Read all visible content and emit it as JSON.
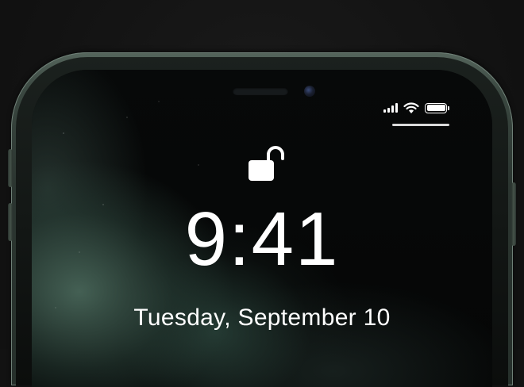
{
  "lock_screen": {
    "time": "9:41",
    "date": "Tuesday, September 10",
    "lock_state": "unlocked"
  },
  "status_bar": {
    "signal_bars": 4,
    "wifi": "wifi-icon",
    "battery_level": 1.0
  },
  "icons": {
    "lock": "unlocked-padlock-icon",
    "signal": "cellular-signal-icon",
    "wifi": "wifi-icon",
    "battery": "battery-icon",
    "camera": "front-camera-icon",
    "speaker": "earpiece-speaker-icon"
  },
  "colors": {
    "frame": "#3a4740",
    "text": "#ffffff",
    "screen": "#050607"
  }
}
